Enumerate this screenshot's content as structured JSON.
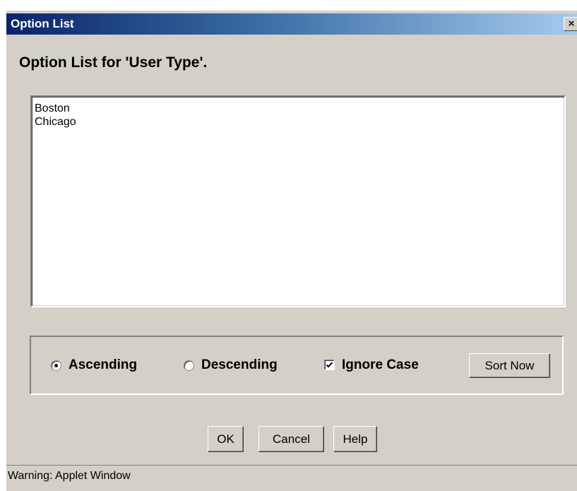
{
  "window": {
    "title": "Option List",
    "close_glyph": "×",
    "close_icon": "close-icon"
  },
  "heading": "Option List for 'User Type'.",
  "list": {
    "items": [
      "Boston",
      "Chicago"
    ]
  },
  "sort": {
    "ascending_label": "Ascending",
    "ascending_selected": true,
    "descending_label": "Descending",
    "descending_selected": false,
    "ignore_case_label": "Ignore Case",
    "ignore_case_checked": true,
    "sort_now_label": "Sort Now"
  },
  "buttons": {
    "ok": "OK",
    "cancel": "Cancel",
    "help": "Help"
  },
  "status": {
    "text": "Warning: Applet Window"
  }
}
